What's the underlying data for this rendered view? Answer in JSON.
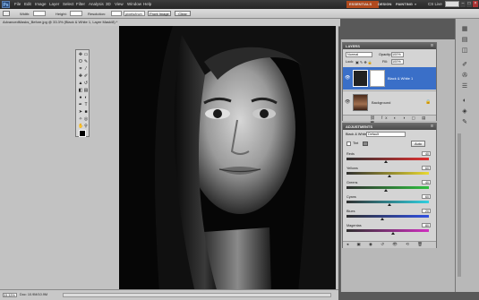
{
  "menubar": {
    "logo": "Ps",
    "items": [
      "File",
      "Edit",
      "Image",
      "Layer",
      "Select",
      "Filter",
      "Analysis",
      "3D",
      "View",
      "Window",
      "Help"
    ],
    "workspaces": {
      "essentials": "ESSENTIALS",
      "design": "DESIGN",
      "painting": "PAINTING",
      "more": "»"
    },
    "cs_live": "CS Live"
  },
  "options_bar": {
    "width_label": "Width:",
    "height_label": "Height:",
    "resolution_label": "Resolution:",
    "resolution_unit": "pixels/inch",
    "front_image": "Front Image",
    "clear": "Clear"
  },
  "document": {
    "tab_title": "AdvancedMasks_Before.jpg @ 33.3% (Black & White 1, Layer Mask/8) *",
    "zoom": "33.33%",
    "doc_size": "Doc: 10.9M/10.9M"
  },
  "layers_panel": {
    "title": "LAYERS",
    "blend_mode": "Normal",
    "opacity_label": "Opacity:",
    "opacity": "100%",
    "lock_label": "Lock:",
    "fill_label": "Fill:",
    "fill": "100%",
    "layers": [
      {
        "name": "Black & White 1",
        "selected": true
      },
      {
        "name": "Background",
        "selected": false
      }
    ]
  },
  "adjustments_panel": {
    "title": "ADJUSTMENTS",
    "preset_label": "Black & White",
    "preset": "Default",
    "tint_label": "Tint",
    "auto_label": "Auto",
    "sliders": [
      {
        "name": "Reds",
        "value": 40,
        "color_a": "#303030",
        "color_b": "#e03030"
      },
      {
        "name": "Yellows",
        "value": 60,
        "color_a": "#303030",
        "color_b": "#e8d830"
      },
      {
        "name": "Greens",
        "value": 40,
        "color_a": "#303030",
        "color_b": "#30c040"
      },
      {
        "name": "Cyans",
        "value": 60,
        "color_a": "#303030",
        "color_b": "#30d0e0"
      },
      {
        "name": "Blues",
        "value": 20,
        "color_a": "#303030",
        "color_b": "#3050e0"
      },
      {
        "name": "Magentas",
        "value": 80,
        "color_a": "#303030",
        "color_b": "#d030c0"
      }
    ]
  },
  "colors": {
    "accent": "#3a6fc8",
    "essentials": "#b04a1e"
  }
}
